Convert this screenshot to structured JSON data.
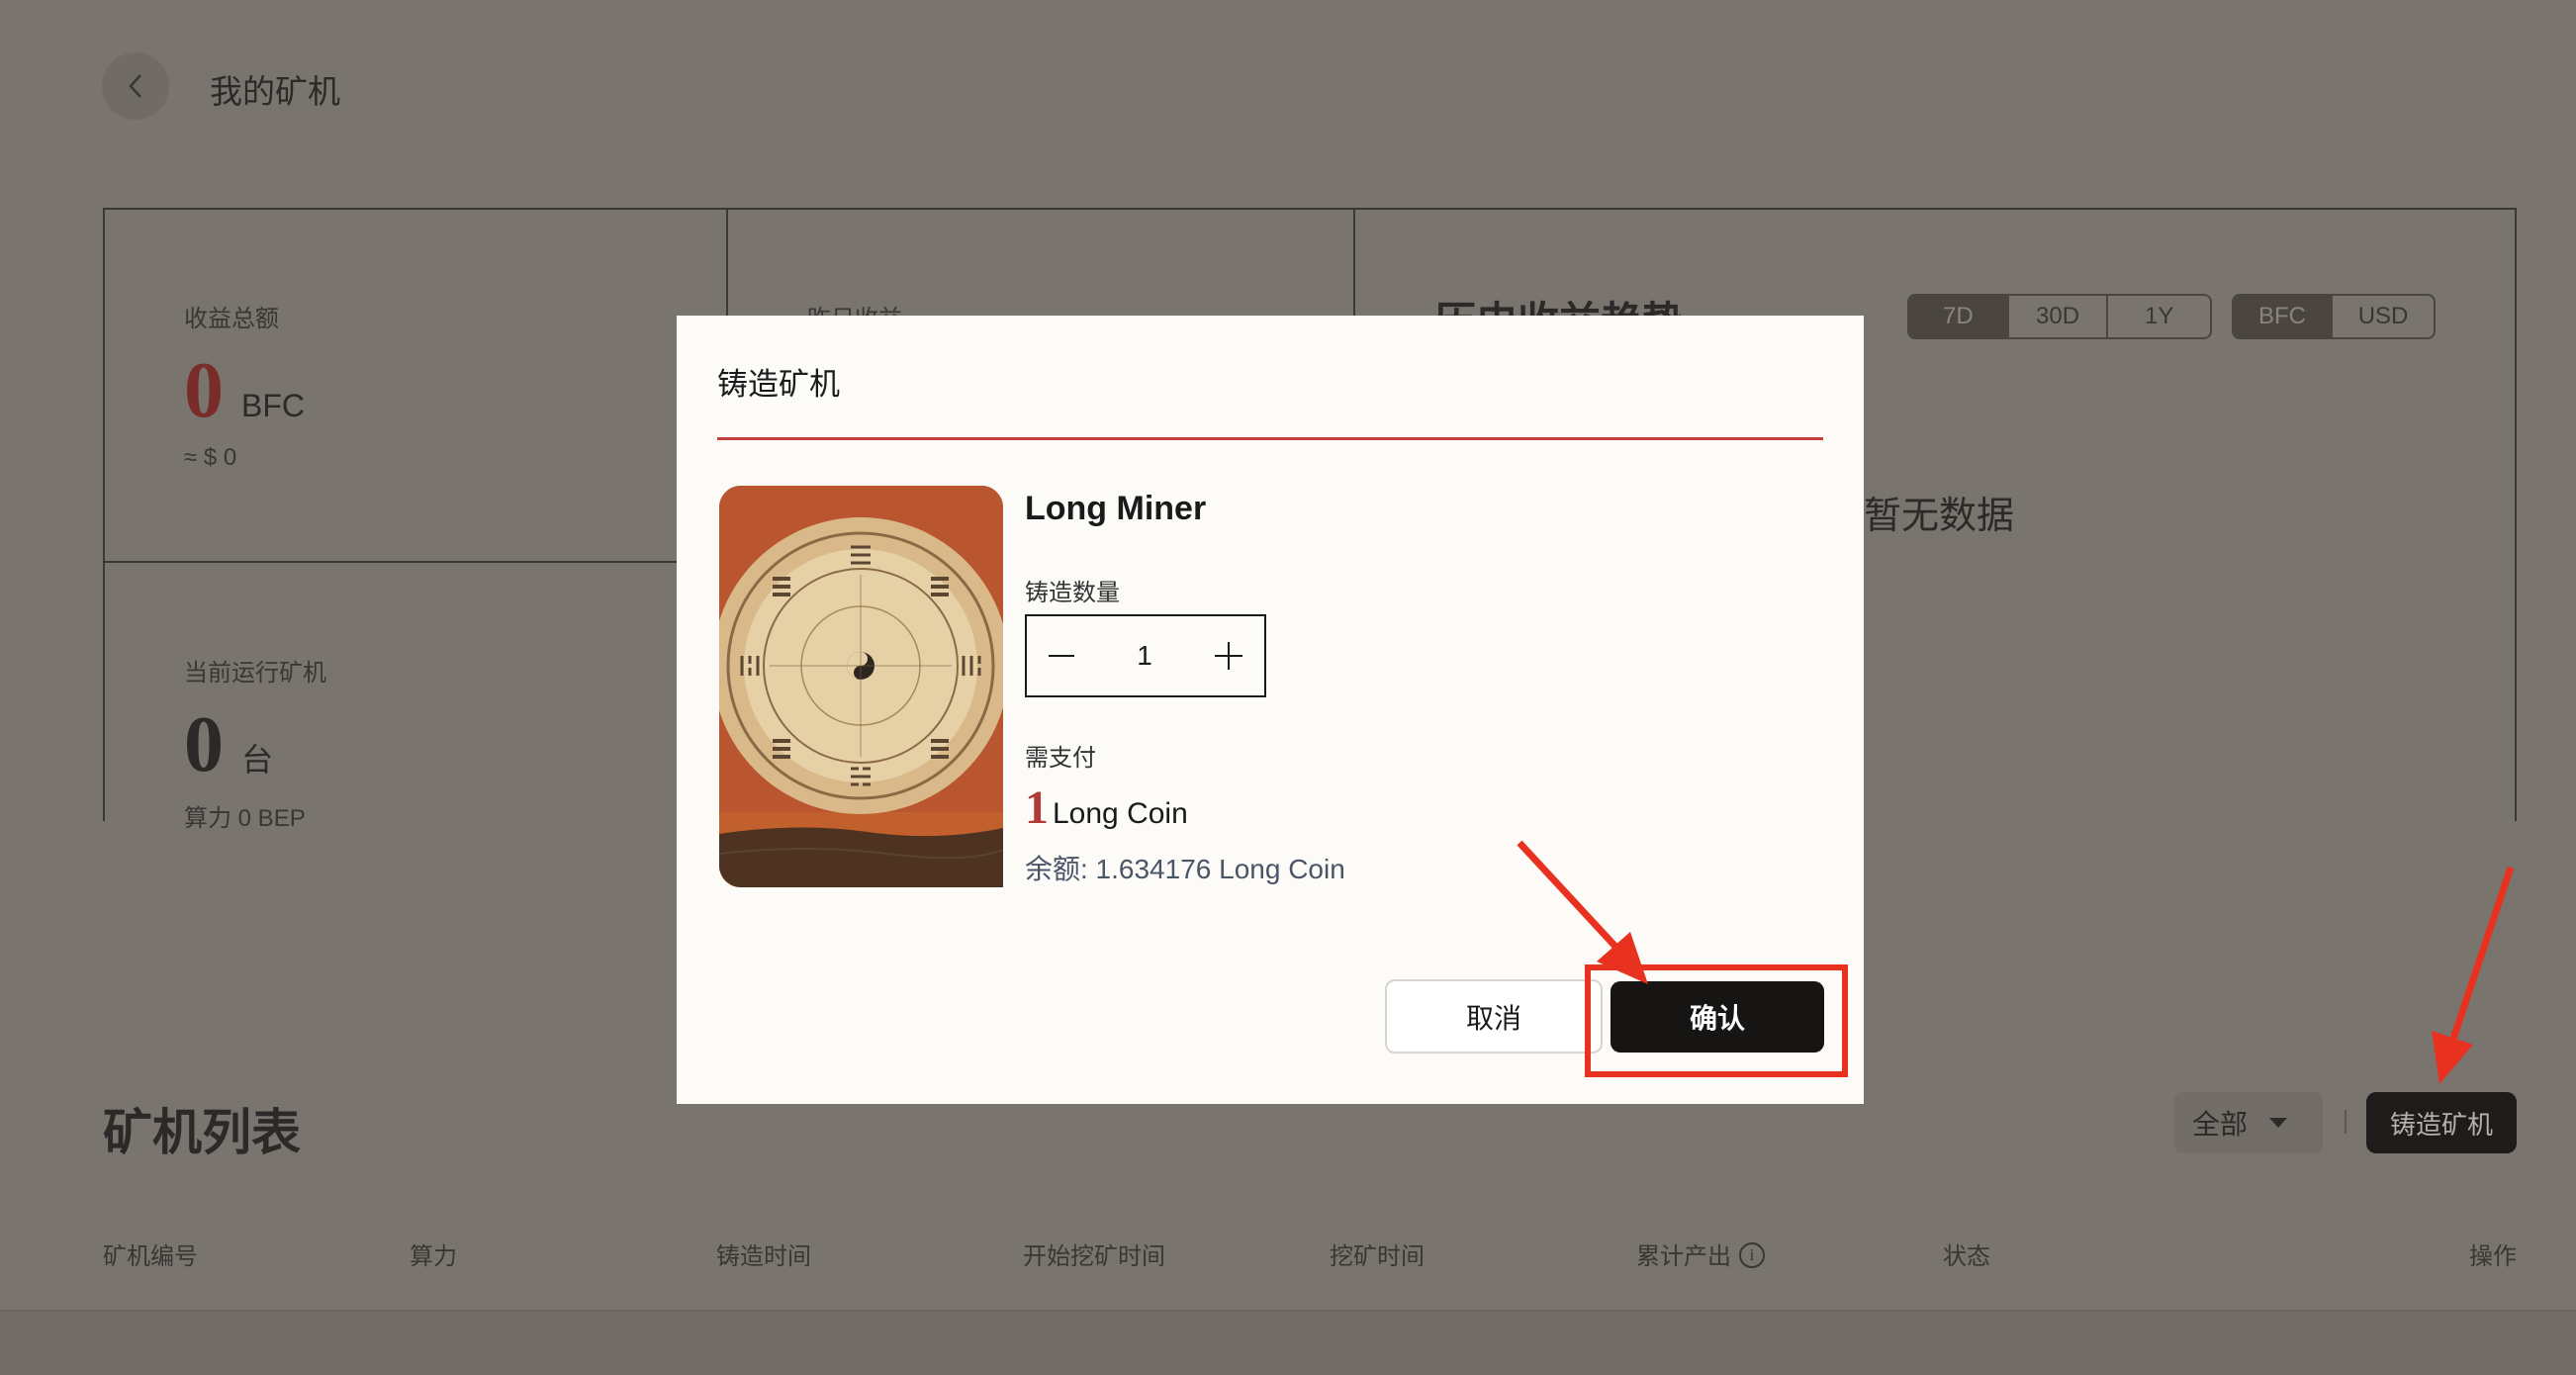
{
  "page": {
    "title": "我的矿机"
  },
  "stats": {
    "total_income": {
      "label": "收益总额",
      "value": "0",
      "unit": "BFC",
      "sub": "≈ $ 0"
    },
    "yesterday_income": {
      "label": "昨日收益"
    },
    "running_miners": {
      "label": "当前运行矿机",
      "value": "0",
      "unit": "台",
      "sub": "算力 0 BEP"
    }
  },
  "trend": {
    "title": "历史收益趋势",
    "range_options": [
      "7D",
      "30D",
      "1Y"
    ],
    "range_selected": "7D",
    "currency_options": [
      "BFC",
      "USD"
    ],
    "currency_selected": "BFC",
    "empty_text": "暂无数据"
  },
  "list": {
    "title": "矿机列表",
    "filter_value": "全部",
    "mint_button": "铸造矿机",
    "columns": [
      "矿机编号",
      "算力",
      "铸造时间",
      "开始挖矿时间",
      "挖矿时间",
      "累计产出",
      "状态",
      "操作"
    ]
  },
  "modal": {
    "title": "铸造矿机",
    "item_name": "Long Miner",
    "quantity_label": "铸造数量",
    "quantity": "1",
    "pay_label": "需支付",
    "pay_amount": "1",
    "pay_currency": "Long Coin",
    "balance": "余额: 1.634176 Long Coin",
    "cancel_label": "取消",
    "confirm_label": "确认"
  },
  "colors": {
    "overlay_bg": "#7a746f",
    "accent_red": "#c4403f",
    "annotation_red": "#e8321f",
    "button_dark": "#161514"
  }
}
